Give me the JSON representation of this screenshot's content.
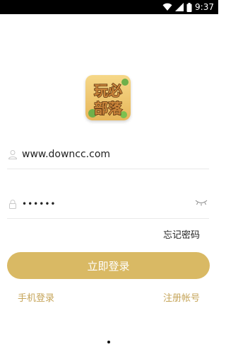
{
  "status_bar": {
    "time": "9:37",
    "icons": [
      "wifi-icon",
      "signal-icon",
      "battery-icon"
    ]
  },
  "logo": {
    "line1": "玩必",
    "line2": "部落"
  },
  "login_form": {
    "username_value": "www.downcc.com",
    "password_value": "••••••",
    "forgot_password_label": "忘记密码",
    "login_button_label": "立即登录",
    "phone_login_label": "手机登录",
    "register_label": "注册帐号"
  },
  "colors": {
    "accent": "#d9b964",
    "link": "#c6a55a"
  }
}
